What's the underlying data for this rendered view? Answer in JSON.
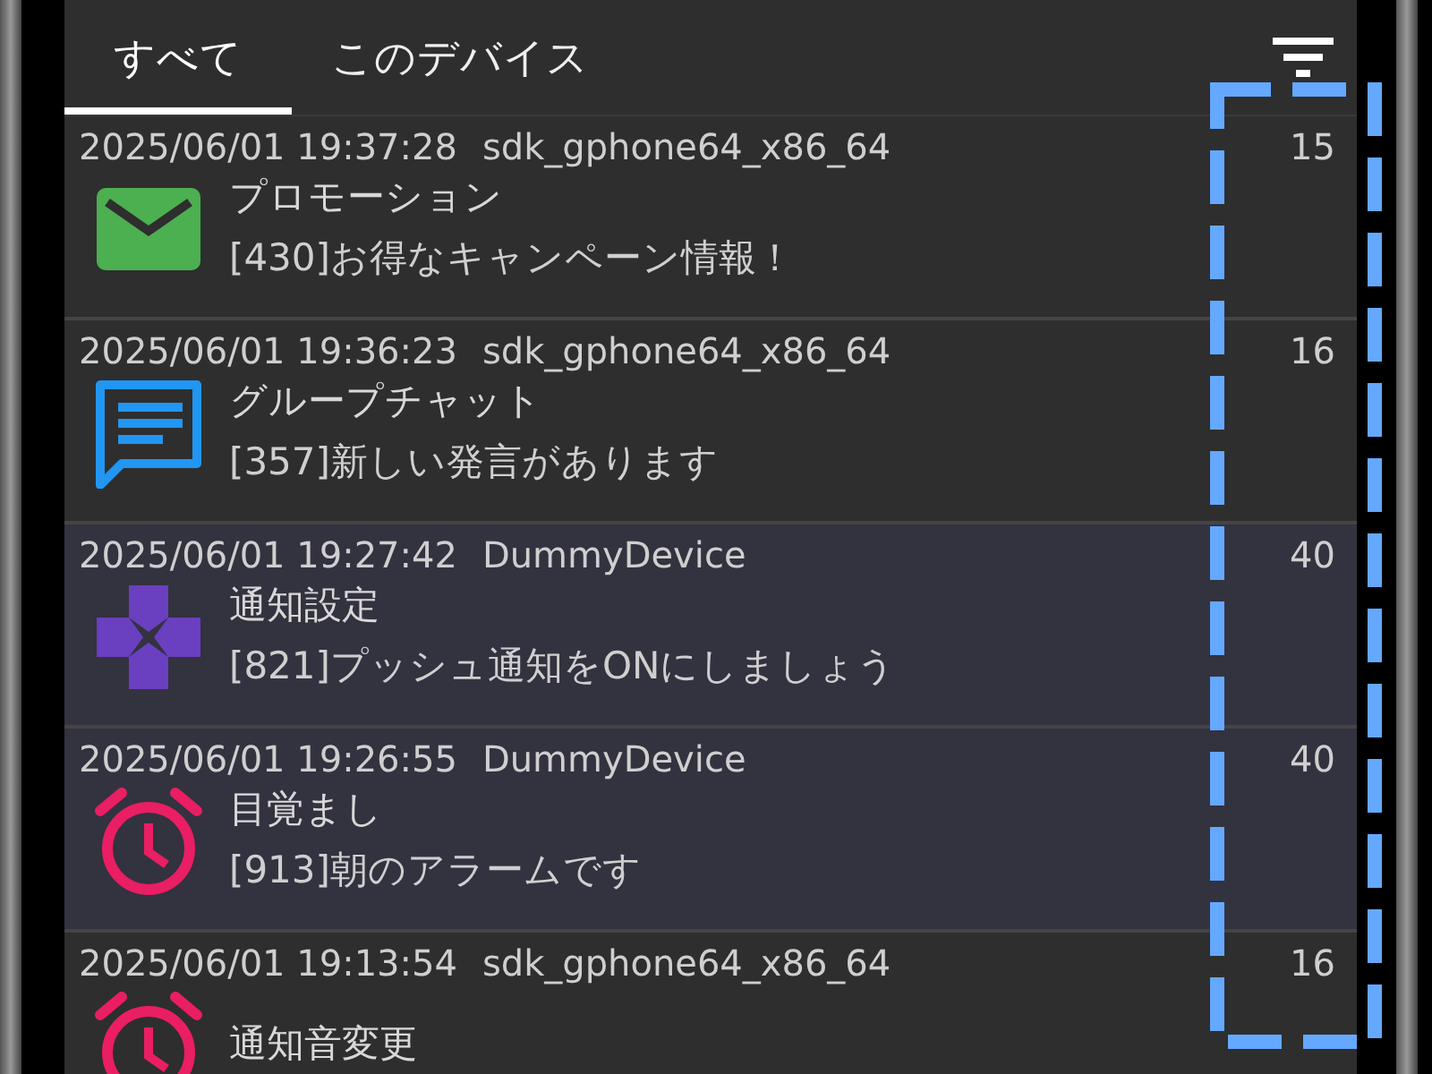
{
  "tabs": [
    {
      "label": "すべて",
      "selected": true
    },
    {
      "label": "このデバイス",
      "selected": false
    }
  ],
  "notifications": [
    {
      "timestamp": "2025/06/01 19:37:28",
      "device": "sdk_gphone64_x86_64",
      "count": "15",
      "kind": "mail",
      "highlighted": false,
      "title": "プロモーション",
      "message": "[430]お得なキャンペーン情報！"
    },
    {
      "timestamp": "2025/06/01 19:36:23",
      "device": "sdk_gphone64_x86_64",
      "count": "16",
      "kind": "chat",
      "highlighted": false,
      "title": "グループチャット",
      "message": "[357]新しい発言があります"
    },
    {
      "timestamp": "2025/06/01 19:27:42",
      "device": "DummyDevice",
      "count": "40",
      "kind": "gamepad",
      "highlighted": true,
      "title": "通知設定",
      "message": "[821]プッシュ通知をONにしましょう"
    },
    {
      "timestamp": "2025/06/01 19:26:55",
      "device": "DummyDevice",
      "count": "40",
      "kind": "alarm",
      "highlighted": true,
      "title": "目覚まし",
      "message": "[913]朝のアラームです"
    },
    {
      "timestamp": "2025/06/01 19:13:54",
      "device": "sdk_gphone64_x86_64",
      "count": "16",
      "kind": "alarm",
      "highlighted": false,
      "title": "通知音変更"
    }
  ]
}
